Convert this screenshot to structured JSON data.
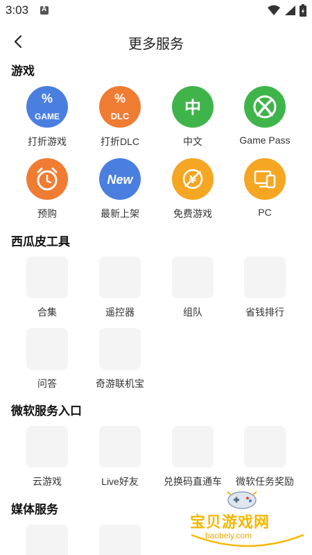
{
  "status": {
    "time": "3:03",
    "badge": "A"
  },
  "header": {
    "title": "更多服务"
  },
  "sections": {
    "games": {
      "title": "游戏",
      "items": [
        {
          "label": "打折游戏",
          "icon": "game-discount-icon",
          "color": "#4a7fe0",
          "glyph": "GAME"
        },
        {
          "label": "打折DLC",
          "icon": "dlc-discount-icon",
          "color": "#f07c33",
          "glyph": "DLC"
        },
        {
          "label": "中文",
          "icon": "chinese-icon",
          "color": "#3fb44a",
          "glyph": "中"
        },
        {
          "label": "Game Pass",
          "icon": "xbox-icon",
          "color": "#3fb44a",
          "glyph": ""
        },
        {
          "label": "预购",
          "icon": "alarm-clock-icon",
          "color": "#f07c33",
          "glyph": ""
        },
        {
          "label": "最新上架",
          "icon": "new-icon",
          "color": "#4a7fe0",
          "glyph": "New"
        },
        {
          "label": "免费游戏",
          "icon": "free-game-icon",
          "color": "#f5a623",
          "glyph": ""
        },
        {
          "label": "PC",
          "icon": "pc-icon",
          "color": "#f5a623",
          "glyph": ""
        }
      ]
    },
    "tools": {
      "title": "西瓜皮工具",
      "items": [
        {
          "label": "合集"
        },
        {
          "label": "遥控器"
        },
        {
          "label": "组队"
        },
        {
          "label": "省钱排行"
        },
        {
          "label": "问答"
        },
        {
          "label": "奇游联机宝"
        }
      ]
    },
    "microsoft": {
      "title": "微软服务入口",
      "items": [
        {
          "label": "云游戏"
        },
        {
          "label": "Live好友"
        },
        {
          "label": "兑换码直通车"
        },
        {
          "label": "微软任务奖励"
        }
      ]
    },
    "media": {
      "title": "媒体服务"
    }
  },
  "watermark": {
    "text": "宝贝游戏网",
    "url": "baobeiy.com"
  }
}
